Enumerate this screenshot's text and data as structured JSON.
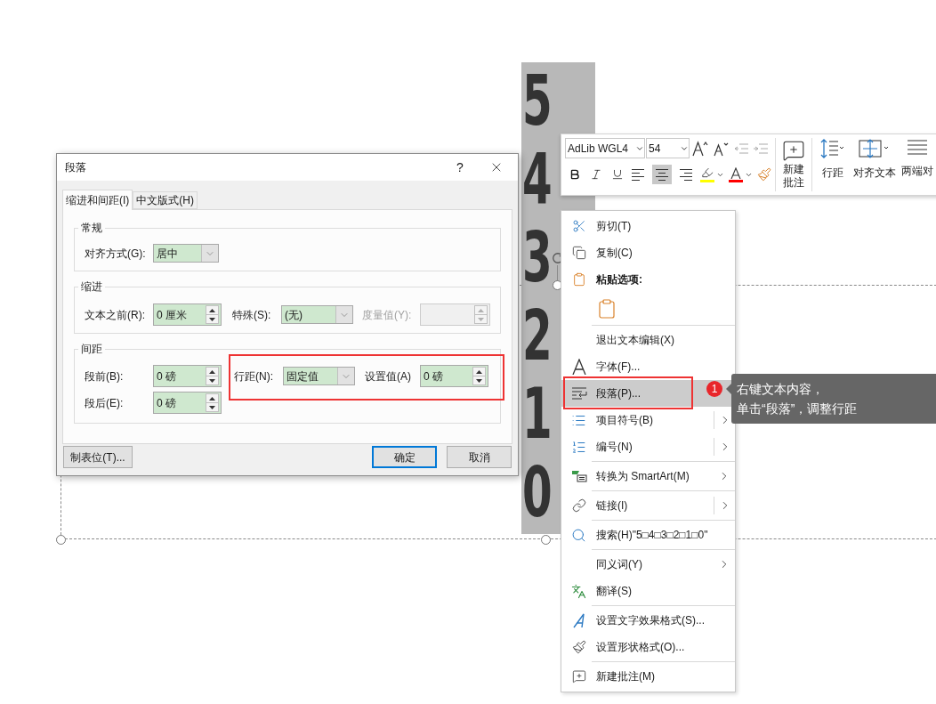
{
  "slide": {
    "digits": [
      "5",
      "4",
      "3",
      "2",
      "1",
      "0"
    ]
  },
  "dialog": {
    "title": "段落",
    "help": "?",
    "tabs": [
      {
        "label": "缩进和间距(I)",
        "selected": true
      },
      {
        "label": "中文版式(H)",
        "selected": false
      }
    ],
    "general": {
      "heading": "常规",
      "alignment": {
        "label": "对齐方式(G):",
        "value": "居中"
      }
    },
    "indentation": {
      "heading": "缩进",
      "before_text": {
        "label": "文本之前(R):",
        "value": "0 厘米"
      },
      "special": {
        "label": "特殊(S):",
        "value": "(无)"
      },
      "by": {
        "label": "度量值(Y):",
        "disabled": true
      }
    },
    "spacing": {
      "heading": "间距",
      "before": {
        "label": "段前(B):",
        "value": "0 磅"
      },
      "after": {
        "label": "段后(E):",
        "value": "0 磅"
      },
      "line_spacing": {
        "label": "行距(N):",
        "value": "固定值"
      },
      "at": {
        "label": "设置值(A)",
        "value": "0 磅"
      },
      "marked": true
    },
    "buttons": {
      "tabs": "制表位(T)...",
      "ok": "确定",
      "cancel": "取消"
    }
  },
  "toolbar": {
    "font": "AdLib WGL4",
    "size": "54",
    "alignment": [
      {
        "selected": false
      },
      {
        "selected": true
      },
      {
        "selected": false
      }
    ],
    "commands": [
      {
        "lines": [
          "新建",
          "批注"
        ]
      },
      {
        "lines": [
          "行距"
        ]
      },
      {
        "lines": [
          "对齐文本"
        ]
      },
      {
        "lines": [
          "两端对"
        ]
      }
    ]
  },
  "context_menu": {
    "items": [
      {
        "kind": "command",
        "label": "剪切(T)",
        "selected": false
      },
      {
        "kind": "command",
        "label": "复制(C)",
        "selected": false
      },
      {
        "kind": "heading",
        "label": "粘贴选项:"
      },
      {
        "kind": "paste_option",
        "selected": false
      },
      {
        "kind": "command",
        "label": "退出文本编辑(X)",
        "selected": false,
        "separator_before": true
      },
      {
        "kind": "command",
        "label": "字体(F)...",
        "selected": false
      },
      {
        "kind": "command",
        "label": "段落(P)...",
        "selected": true,
        "marked": true
      },
      {
        "kind": "command",
        "label": "项目符号(B)",
        "selected": false,
        "submenu": true,
        "split": true
      },
      {
        "kind": "command",
        "label": "编号(N)",
        "selected": false,
        "submenu": true,
        "split": true
      },
      {
        "kind": "command",
        "label": "转换为 SmartArt(M)",
        "selected": false,
        "submenu": true,
        "separator_before": true
      },
      {
        "kind": "command",
        "label": "链接(I)",
        "selected": false,
        "submenu": true,
        "split": true,
        "separator_before": true
      },
      {
        "kind": "command",
        "label": "搜索(H)\"5□4□3□2□1□0\"",
        "selected": false,
        "separator_before": true
      },
      {
        "kind": "command",
        "label": "同义词(Y)",
        "selected": false,
        "submenu": true,
        "separator_before": true
      },
      {
        "kind": "command",
        "label": "翻译(S)",
        "selected": false
      },
      {
        "kind": "command",
        "label": "设置文字效果格式(S)...",
        "selected": false,
        "separator_before": true
      },
      {
        "kind": "command",
        "label": "设置形状格式(O)...",
        "selected": false
      },
      {
        "kind": "command",
        "label": "新建批注(M)",
        "selected": false,
        "separator_before": true
      }
    ]
  },
  "callout": {
    "badge": "1",
    "lines": [
      "右键文本内容，",
      "单击“段落”，调整行距"
    ]
  }
}
